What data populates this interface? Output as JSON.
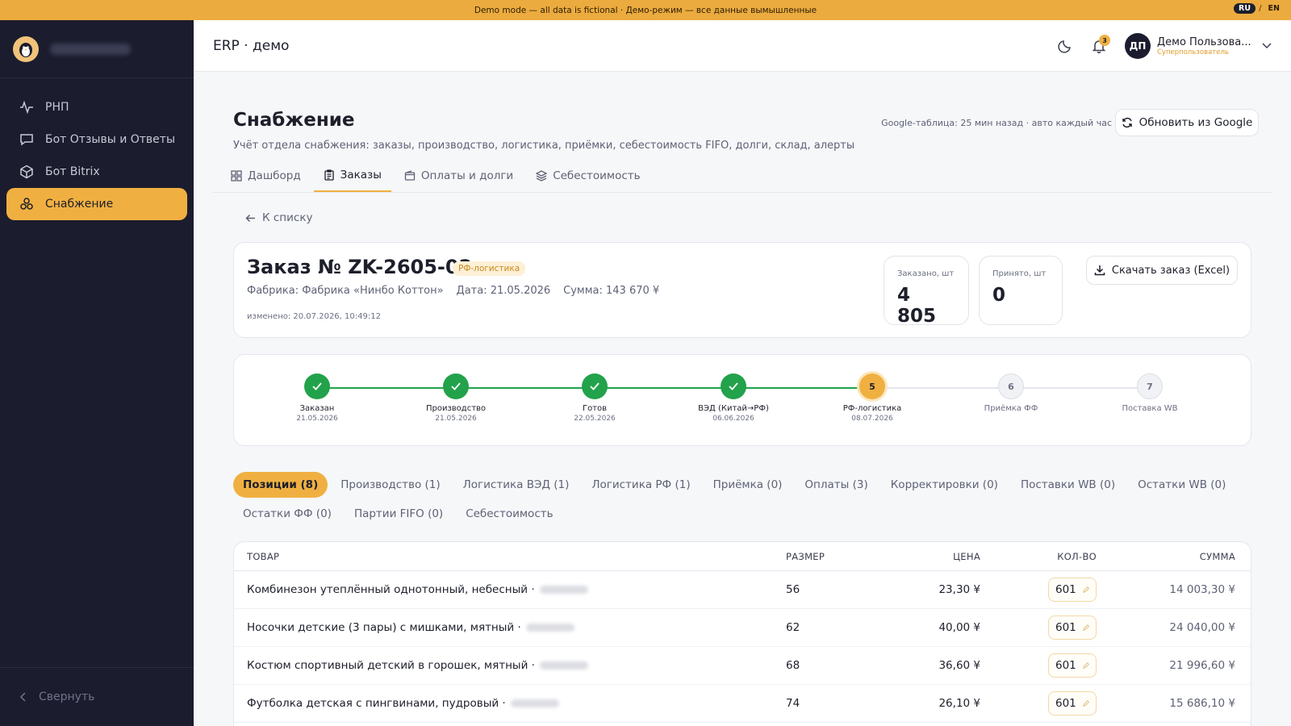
{
  "banner": {
    "text": "Demo mode — all data is fictional · Демо-режим — все данные вымышленные",
    "lang_ru": "RU",
    "lang_sep": "/",
    "lang_en": "EN"
  },
  "sidebar": {
    "items": [
      {
        "label": "РНП",
        "icon": "pulse-icon"
      },
      {
        "label": "Бот Отзывы и Ответы",
        "icon": "chat-icon"
      },
      {
        "label": "Бот Bitrix",
        "icon": "cube-icon"
      },
      {
        "label": "Снабжение",
        "icon": "boxes-icon",
        "active": true
      }
    ],
    "collapse_label": "Свернуть"
  },
  "header": {
    "title": "ERP · демо",
    "notifications": "3",
    "user_initials": "ДП",
    "user_name": "Демо Пользова...",
    "user_role": "Суперпользователь"
  },
  "page": {
    "title": "Снабжение",
    "subtitle": "Учёт отдела снабжения: заказы, производство, логистика, приёмки, себестоимость FIFO, долги, склад, алерты",
    "sync_status": "Google-таблица: 25 мин назад · авто каждый час",
    "refresh_label": "Обновить из Google",
    "tabs": [
      {
        "label": "Дашборд",
        "icon": "grid-icon"
      },
      {
        "label": "Заказы",
        "icon": "clipboard-icon",
        "active": true
      },
      {
        "label": "Оплаты и долги",
        "icon": "wallet-icon"
      },
      {
        "label": "Себестоимость",
        "icon": "layers-icon"
      }
    ],
    "back_label": "К списку"
  },
  "order": {
    "title": "Заказ № ZK-2605-02",
    "badge": "РФ-логистика",
    "factory": "Фабрика: Фабрика «Нинбо Коттон»",
    "date": "Дата: 21.05.2026",
    "sum": "Сумма: 143 670 ¥",
    "modified": "изменено: 20.07.2026, 10:49:12",
    "ordered_label": "Заказано, шт",
    "ordered_value": "4 805",
    "received_label": "Принято, шт",
    "received_value": "0",
    "excel_label": "Скачать заказ (Excel)"
  },
  "steps": [
    {
      "label": "Заказан",
      "date": "21.05.2026",
      "state": "done",
      "num": "1"
    },
    {
      "label": "Производство",
      "date": "21.05.2026",
      "state": "done",
      "num": "2"
    },
    {
      "label": "Готов",
      "date": "22.05.2026",
      "state": "done",
      "num": "3"
    },
    {
      "label": "ВЭД (Китай→РФ)",
      "date": "06.06.2026",
      "state": "done",
      "num": "4"
    },
    {
      "label": "РФ-логистика",
      "date": "08.07.2026",
      "state": "current",
      "num": "5"
    },
    {
      "label": "Приёмка ФФ",
      "date": "",
      "state": "pending",
      "num": "6"
    },
    {
      "label": "Поставка WB",
      "date": "",
      "state": "pending",
      "num": "7"
    }
  ],
  "subtabs": [
    [
      "Позиции (8)",
      "Производство (1)",
      "Логистика ВЭД (1)",
      "Логистика РФ (1)",
      "Приёмка (0)",
      "Оплаты (3)",
      "Корректировки (0)",
      "Поставки WB (0)",
      "Остатки WB (0)"
    ],
    [
      "Остатки ФФ (0)",
      "Партии FIFO (0)",
      "Себестоимость"
    ]
  ],
  "table": {
    "headers": {
      "product": "ТОВАР",
      "size": "РАЗМЕР",
      "price": "ЦЕНА",
      "qty": "КОЛ-ВО",
      "sum": "СУММА"
    },
    "rows": [
      {
        "product": "Комбинезон утеплённый однотонный, небесный ·",
        "size": "56",
        "price": "23,30 ¥",
        "qty": "601",
        "sum": "14 003,30 ¥"
      },
      {
        "product": "Носочки детские (3 пары) с мишками, мятный ·",
        "size": "62",
        "price": "40,00 ¥",
        "qty": "601",
        "sum": "24 040,00 ¥"
      },
      {
        "product": "Костюм спортивный детский в горошек, мятный ·",
        "size": "68",
        "price": "36,60 ¥",
        "qty": "601",
        "sum": "21 996,60 ¥"
      },
      {
        "product": "Футболка детская с пингвинами, пудровый ·",
        "size": "74",
        "price": "26,10 ¥",
        "qty": "601",
        "sum": "15 686,10 ¥"
      }
    ]
  },
  "colors": {
    "accent": "#f0b041",
    "sidebar_bg": "#1b1c2e",
    "done": "#22a24b"
  }
}
